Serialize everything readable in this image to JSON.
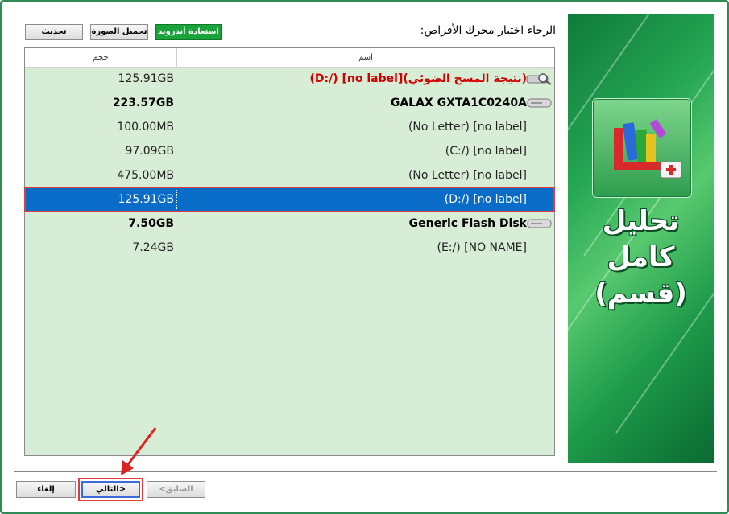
{
  "side_panel": {
    "title_line1": "تحليل",
    "title_line2": "كامل",
    "title_line3": "(قسم)",
    "icon": "partition-recovery-icon"
  },
  "prompt": "الرجاء اختيار محرك الأقراص:",
  "toolbar": {
    "android_label": "استعادة أندرويد",
    "load_image_label": "تحميل الصورة",
    "refresh_label": "تحديث"
  },
  "table": {
    "col_name": "اسم",
    "col_size": "حجم",
    "rows": [
      {
        "size": "125.91GB",
        "name": "(D:/) [no label](نتيجة المسح الضوئي)",
        "icon": "scan-drive-icon"
      },
      {
        "size": "223.57GB",
        "name": "GALAX GXTA1C0240A",
        "icon": "hard-disk-icon"
      },
      {
        "size": "100.00MB",
        "name": "(No Letter) [no label]"
      },
      {
        "size": "97.09GB",
        "name": "(C:/) [no label]"
      },
      {
        "size": "475.00MB",
        "name": "(No Letter) [no label]"
      },
      {
        "size": "125.91GB",
        "name": "(D:/) [no label]"
      },
      {
        "size": "7.50GB",
        "name": "Generic Flash Disk",
        "icon": "hard-disk-icon"
      },
      {
        "size": "7.24GB",
        "name": "(E:/) [NO NAME]"
      }
    ]
  },
  "footer": {
    "cancel_label": "إلغاء",
    "next_label": "التالي>",
    "back_label": "<السابق"
  },
  "colors": {
    "accent_green": "#1aa33b",
    "selection_blue": "#0a6cc9",
    "highlight_red": "#e23b3b"
  }
}
